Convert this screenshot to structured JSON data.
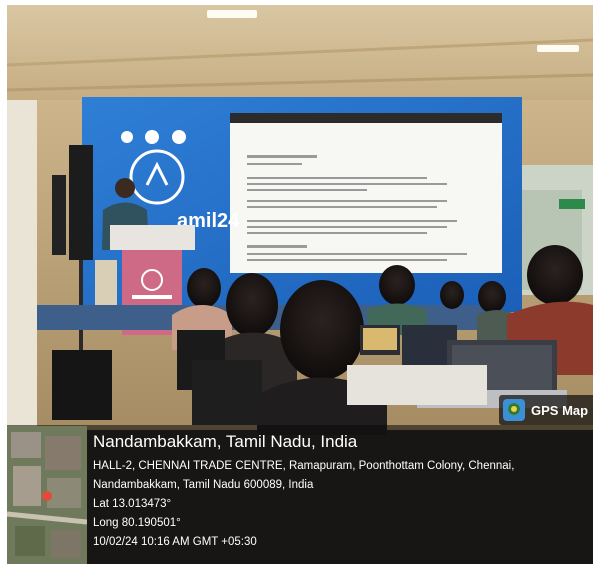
{
  "photo": {
    "description": "Speaker at a podium on stage with a projected slide; audience with laptops seated in the foreground"
  },
  "stage": {
    "banner_text": "amil24"
  },
  "gps_overlay": {
    "app_name": "GPS Map",
    "location_title": "Nandambakkam, Tamil Nadu, India",
    "address_line_1": "HALL-2, CHENNAI TRADE CENTRE, Ramapuram, Poonthottam Colony, Chennai,",
    "address_line_2": "Nandambakkam, Tamil Nadu 600089, India",
    "latitude": "Lat 13.013473°",
    "longitude": "Long 80.190501°",
    "timestamp": "10/02/24 10:16 AM GMT +05:30"
  }
}
